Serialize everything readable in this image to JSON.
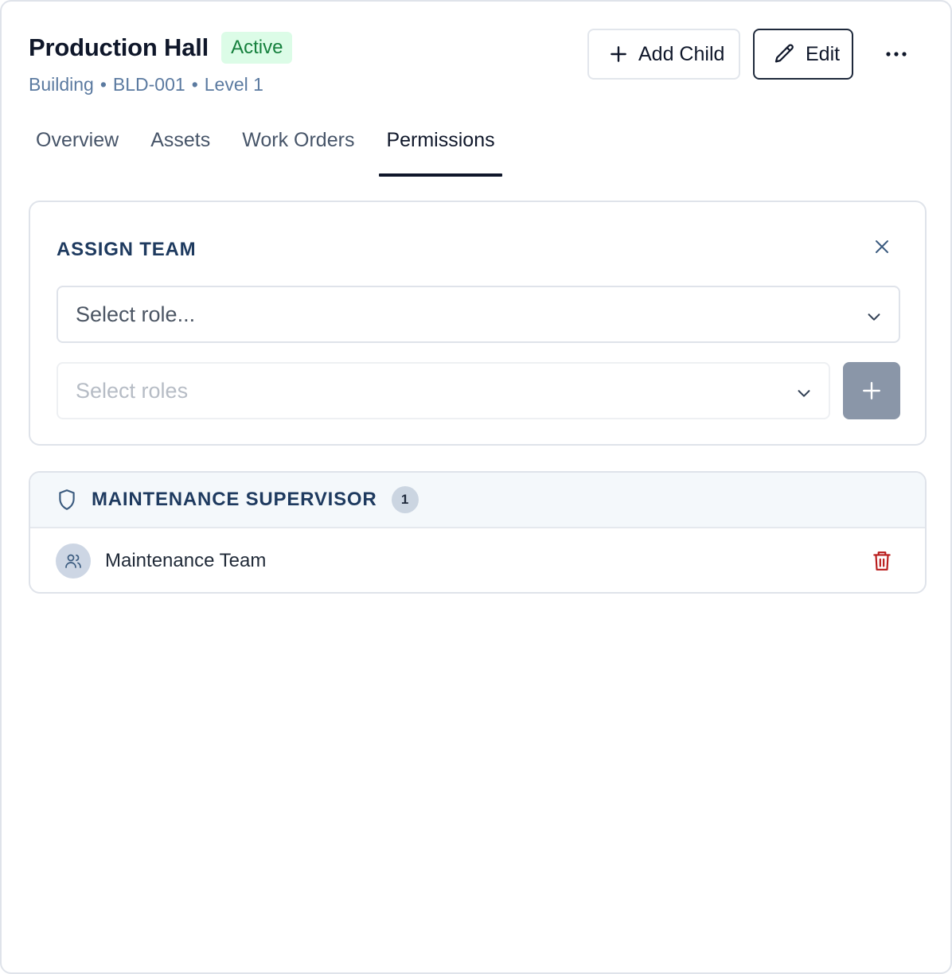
{
  "header": {
    "title": "Production Hall",
    "status_badge": "Active",
    "subtitle": {
      "type": "Building",
      "code": "BLD-001",
      "level": "Level 1",
      "separator": "•"
    },
    "add_child_label": "Add Child",
    "edit_label": "Edit",
    "more_icon": "more-horizontal-icon"
  },
  "tabs": [
    {
      "label": "Overview",
      "active": false
    },
    {
      "label": "Assets",
      "active": false
    },
    {
      "label": "Work Orders",
      "active": false
    },
    {
      "label": "Permissions",
      "active": true
    }
  ],
  "assign_team": {
    "title": "ASSIGN TEAM",
    "role_select_placeholder": "Select role...",
    "roles_select_placeholder": "Select roles"
  },
  "role_groups": [
    {
      "name": "MAINTENANCE SUPERVISOR",
      "count": "1",
      "members": [
        {
          "name": "Maintenance Team"
        }
      ]
    }
  ],
  "colors": {
    "active_badge_bg": "#dcfce7",
    "active_badge_text": "#15803d",
    "delete_red": "#b91c1c",
    "add_button_bg": "#8a96a8",
    "heading_navy": "#1e3a5f"
  }
}
